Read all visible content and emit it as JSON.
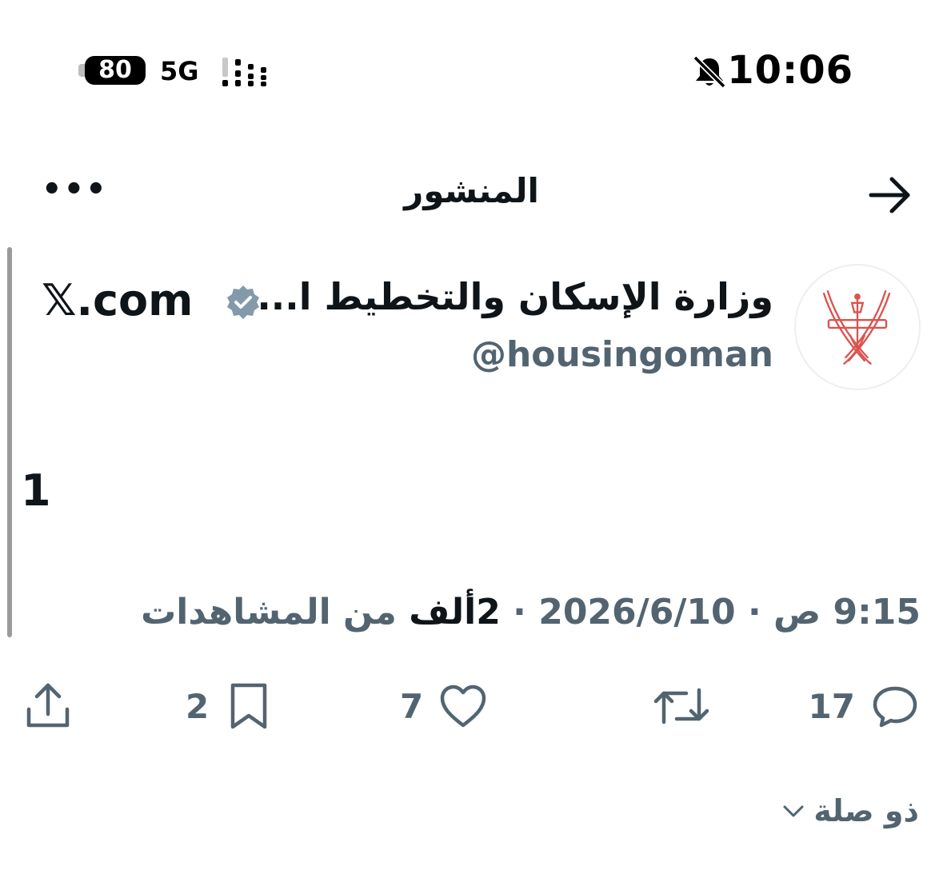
{
  "status_bar": {
    "time": "10:06",
    "battery": "80",
    "network": "5G",
    "icons": [
      "bell-slash-icon",
      "battery-icon",
      "signal-icon"
    ]
  },
  "header": {
    "title": "المنشور",
    "more_label": "•••"
  },
  "post": {
    "author_name": "وزارة الإسكان والتخطيط ا...",
    "handle": "@housingoman",
    "source": "𝕏.com",
    "body": "1",
    "meta": {
      "date": "2026/6/10",
      "time": "9:15 ص",
      "views_count": "2ألف",
      "views_label": "من المشاهدات",
      "separator": "·"
    }
  },
  "actions": {
    "replies": "17",
    "likes": "7",
    "bookmarks": "2"
  },
  "related": {
    "label": "ذو صلة"
  },
  "colors": {
    "text": "#0f1419",
    "muted": "#536471",
    "verified": "#829aab",
    "emblem": "#d9544f"
  }
}
